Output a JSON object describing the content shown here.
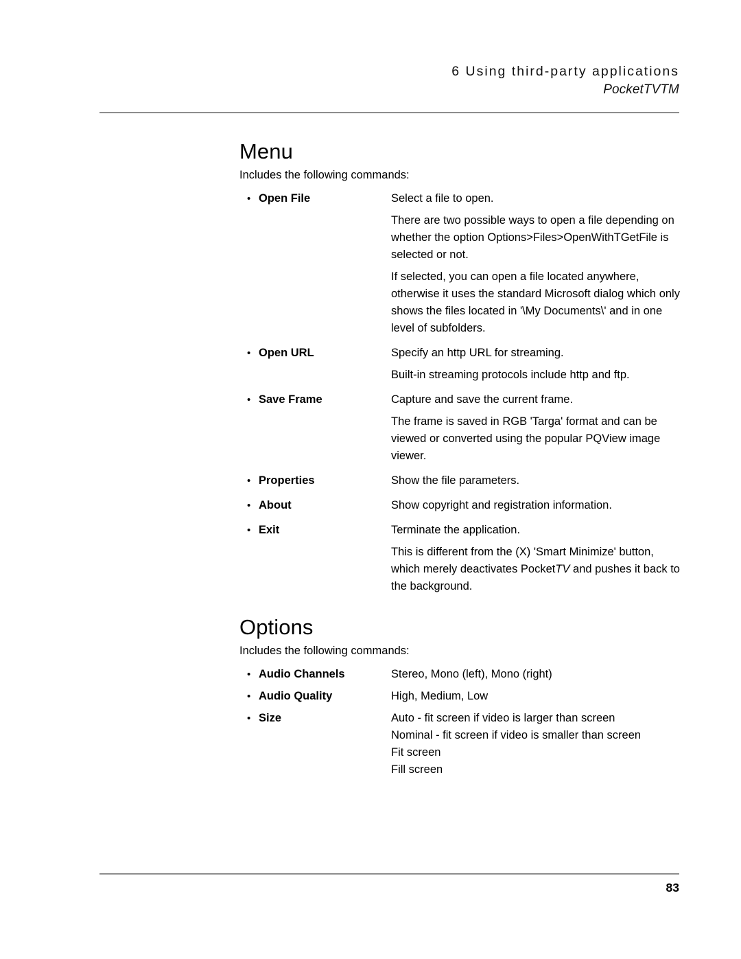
{
  "header": {
    "chapter": "6 Using third-party applications",
    "product": "PocketTVTM"
  },
  "footer": {
    "page_number": "83"
  },
  "sections": [
    {
      "title": "Menu",
      "intro": "Includes the following commands:",
      "items": [
        {
          "term": "Open File",
          "descriptions": [
            "Select a file to open.",
            "There are two possible ways to open a file depending on whether the option Options>Files>OpenWithTGetFile is selected or not.",
            "If selected, you can open a file located anywhere, otherwise it uses the standard Microsoft dialog which only shows the files located in '\\My Documents\\' and in one level of subfolders."
          ]
        },
        {
          "term": "Open URL",
          "descriptions": [
            "Specify an http URL for streaming.",
            "Built-in streaming protocols include http and ftp."
          ]
        },
        {
          "term": "Save Frame",
          "descriptions": [
            "Capture and save the current frame.",
            "The frame is saved in RGB 'Targa' format and can be viewed or converted using the popular PQView image viewer."
          ]
        },
        {
          "term": "Properties",
          "descriptions": [
            "Show the file parameters."
          ]
        },
        {
          "term": "About",
          "descriptions": [
            "Show copyright and registration information."
          ]
        },
        {
          "term": "Exit",
          "descriptions": [
            "Terminate the application."
          ],
          "rich_description": {
            "before": "This is different from the (X) 'Smart Minimize' button, which merely deactivates Pocket",
            "italic": "TV",
            "after": " and pushes it back to the background."
          }
        }
      ]
    },
    {
      "title": "Options",
      "intro": "Includes the following commands:",
      "items": [
        {
          "term": "Audio Channels",
          "descriptions": [
            "Stereo, Mono (left), Mono (right)"
          ]
        },
        {
          "term": "Audio Quality",
          "descriptions": [
            "High, Medium, Low"
          ]
        },
        {
          "term": "Size",
          "descriptions": [
            "Auto - fit screen if video is larger than screen",
            "Nominal - fit screen if video is smaller than screen",
            "Fit screen",
            "Fill screen"
          ]
        }
      ]
    }
  ],
  "icons": {
    "bullet": "•"
  }
}
